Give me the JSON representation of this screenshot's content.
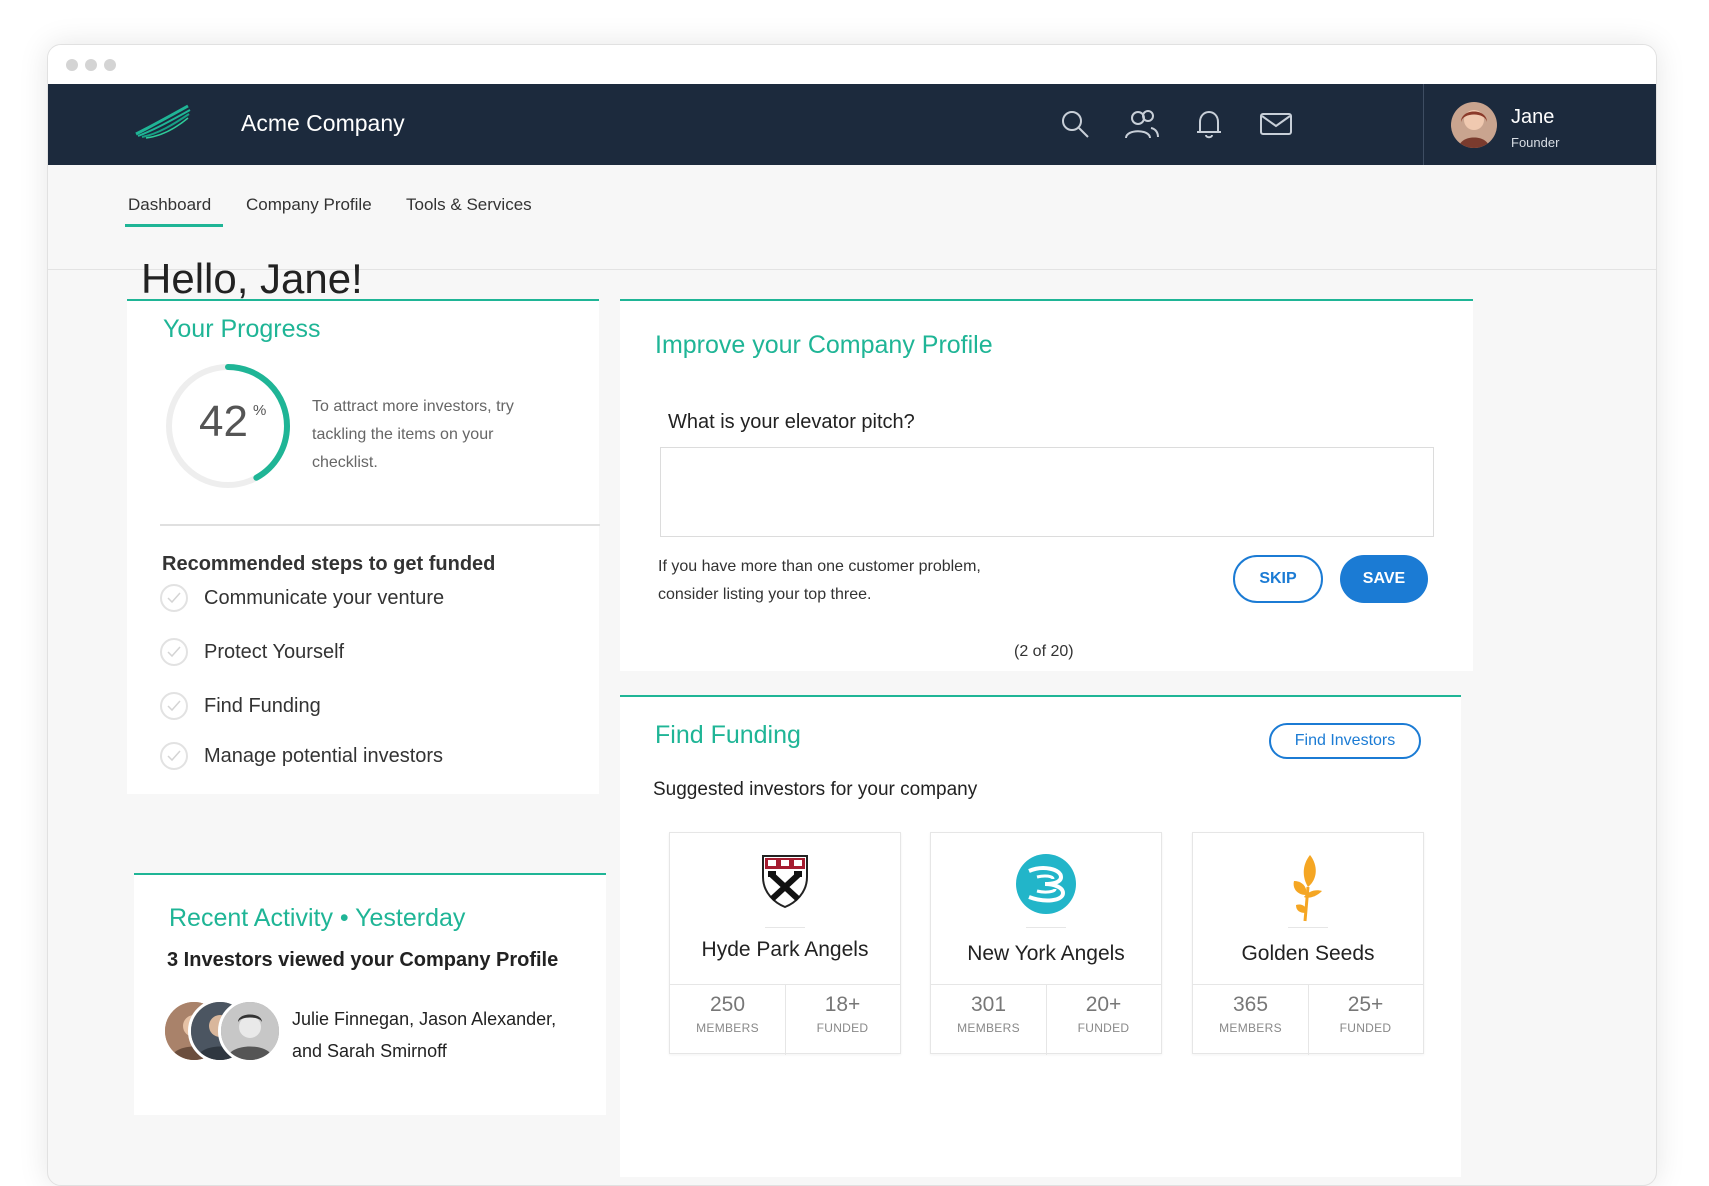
{
  "app": {
    "company": "Acme Company",
    "user": {
      "name": "Jane",
      "role": "Founder"
    }
  },
  "topbar_icons": [
    "search-icon",
    "people-icon",
    "bell-icon",
    "mail-icon"
  ],
  "tabs": [
    {
      "label": "Dashboard",
      "active": true
    },
    {
      "label": "Company Profile",
      "active": false
    },
    {
      "label": "Tools & Services",
      "active": false
    }
  ],
  "greeting": "Hello, Jane!",
  "progress": {
    "title": "Your Progress",
    "percent": 42,
    "percent_value": "42",
    "percent_sign": "%",
    "text": "To attract more investors, try tackling the items on your checklist.",
    "steps_title": "Recommended steps to get funded",
    "steps": [
      "Communicate your venture",
      "Protect Yourself",
      "Find Funding",
      "Manage potential investors"
    ]
  },
  "improve": {
    "title": "Improve your Company Profile",
    "question": "What is your elevator pitch?",
    "answer": "",
    "hint_line1": "If you have more than one customer problem,",
    "hint_line2": "consider listing your top three.",
    "skip_label": "SKIP",
    "save_label": "SAVE",
    "counter": "(2 of 20)"
  },
  "activity": {
    "title": "Recent Activity • Yesterday",
    "headline": "3 Investors viewed your Company Profile",
    "names_line1": "Julie Finnegan, Jason Alexander,",
    "names_line2": "and Sarah Smirnoff"
  },
  "funding": {
    "title": "Find Funding",
    "button": "Find Investors",
    "subtitle": "Suggested investors for your company",
    "investors": [
      {
        "name": "Hyde Park Angels",
        "members": "250",
        "members_label": "MEMBERS",
        "funded": "18+",
        "funded_label": "FUNDED"
      },
      {
        "name": "New York Angels",
        "members": "301",
        "members_label": "MEMBERS",
        "funded": "20+",
        "funded_label": "FUNDED"
      },
      {
        "name": "Golden Seeds",
        "members": "365",
        "members_label": "MEMBERS",
        "funded": "25+",
        "funded_label": "FUNDED"
      }
    ]
  },
  "colors": {
    "navy": "#1c2a3d",
    "accent_green": "#1fb596",
    "accent_blue": "#1b7bd4"
  }
}
